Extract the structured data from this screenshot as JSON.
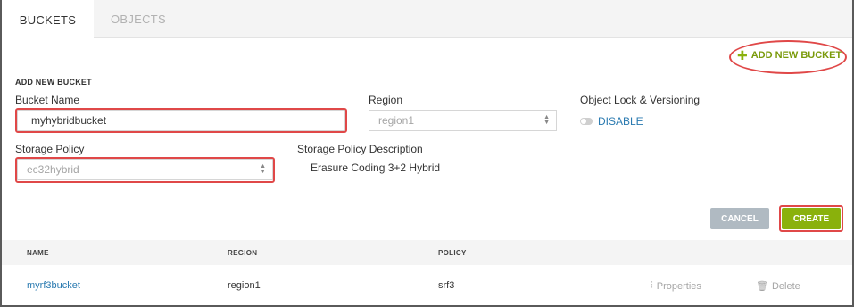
{
  "tabs": [
    {
      "label": "BUCKETS",
      "active": true
    },
    {
      "label": "OBJECTS",
      "active": false
    }
  ],
  "add_bucket": {
    "label": "ADD NEW BUCKET",
    "icon": "plus-icon"
  },
  "form": {
    "title": "ADD NEW BUCKET",
    "bucket_name": {
      "label": "Bucket Name",
      "value": "myhybridbucket"
    },
    "region": {
      "label": "Region",
      "value": "region1"
    },
    "object_lock": {
      "label": "Object Lock & Versioning",
      "state": "DISABLE"
    },
    "storage_policy": {
      "label": "Storage Policy",
      "value": "ec32hybrid"
    },
    "policy_description": {
      "label": "Storage Policy Description",
      "value": "Erasure Coding 3+2 Hybrid"
    },
    "cancel_label": "CANCEL",
    "create_label": "CREATE"
  },
  "table": {
    "headers": [
      "NAME",
      "REGION",
      "POLICY"
    ],
    "rows": [
      {
        "name": "myrf3bucket",
        "region": "region1",
        "policy": "srf3",
        "properties": "Properties",
        "delete": "Delete"
      }
    ]
  },
  "colors": {
    "accent": "#8ab10c",
    "link": "#2a7ab0",
    "highlight": "#e04848",
    "cancel": "#b0bac2"
  }
}
